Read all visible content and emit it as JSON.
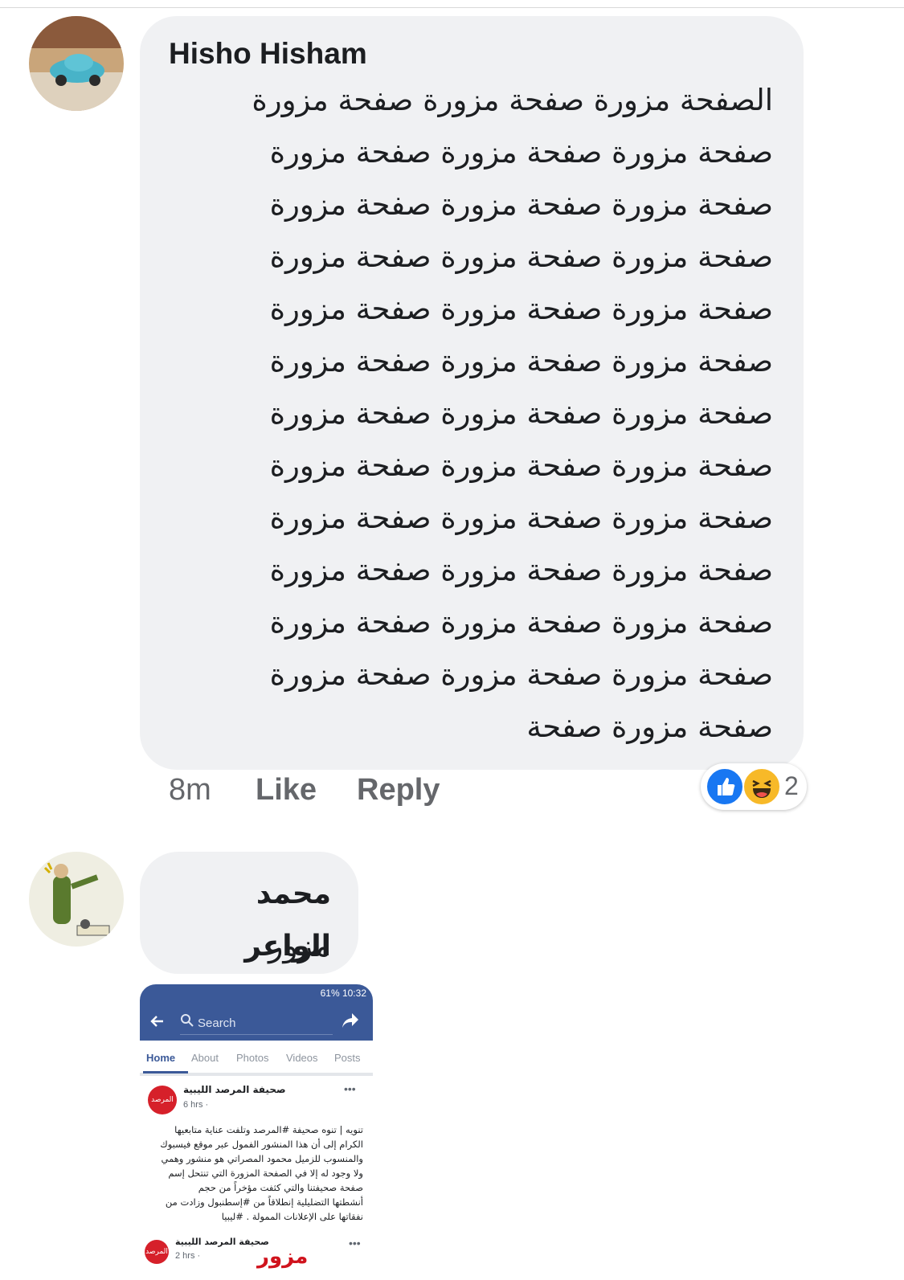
{
  "comments": [
    {
      "author": "Hisho Hisham",
      "lines": [
        "الصفحة مزورة صفحة مزورة صفحة مزورة",
        "صفحة مزورة صفحة مزورة صفحة مزورة",
        "صفحة مزورة صفحة مزورة صفحة مزورة",
        "صفحة مزورة صفحة مزورة صفحة مزورة",
        "صفحة مزورة صفحة مزورة صفحة مزورة",
        "صفحة مزورة صفحة مزورة صفحة مزورة",
        "صفحة مزورة صفحة مزورة صفحة مزورة",
        "صفحة مزورة صفحة مزورة صفحة مزورة",
        "صفحة مزورة صفحة مزورة صفحة مزورة",
        "صفحة مزورة صفحة مزورة صفحة مزورة",
        "صفحة مزورة صفحة مزورة صفحة مزورة",
        "صفحة مزورة صفحة مزورة صفحة مزورة",
        "صفحة مزورة صفحة"
      ],
      "time": "8m",
      "like_label": "Like",
      "reply_label": "Reply",
      "reaction_count": "2",
      "reactions": [
        "like-icon",
        "haha-icon"
      ]
    },
    {
      "author": "محمد الواعر",
      "text": "مزور"
    }
  ],
  "attachment": {
    "status_bar": "61% 10:32",
    "search_label": "Search",
    "tabs": [
      "Home",
      "About",
      "Photos",
      "Videos",
      "Posts"
    ],
    "page_name": "صحيفة المرصد الليبية",
    "post_time": "6 hrs ·",
    "post_lines": [
      "تنويه | تنوه صحيفة #المرصد وتلفت عناية متابعيها",
      "الكرام إلى أن هذا المنشور الفمول عبر موقع فيسبوك",
      "والمنسوب للزميل محمود المصراتي هو منشور وهمي",
      "ولا وجود له إلا في الصفحة المزورة التي تنتحل إسم",
      "صفحة صحيفتنا والتي كثفت مؤخراً من حجم",
      "أنشطتها التضليلية إنطلاقاً من #إسطنبول وزادت من",
      "نفقاتها على الإعلانات الممولة . #ليبيا"
    ],
    "second_page_name": "صحيفة المرصد الليبية",
    "second_time": "2 hrs ·",
    "fake_label": "مزور",
    "logo_text": "المرصد",
    "colors": {
      "fb_blue": "#3b5998",
      "red": "#d0131d"
    }
  }
}
